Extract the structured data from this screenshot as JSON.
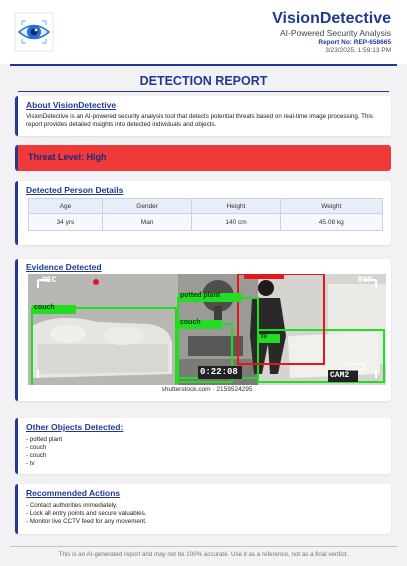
{
  "header": {
    "brand_name": "VisionDetective",
    "tagline": "AI-Powered Security Analysis",
    "report_no": "Report No: REP-658665",
    "report_date": "3/23/2025, 1:59:13 PM"
  },
  "title": "DETECTION REPORT",
  "about": {
    "heading": "About VisionDetective",
    "text": "VisionDetective is an AI-powered security analysis tool that detects potential threats based on real-time image processing. This report provides detailed insights into detected individuals and objects."
  },
  "threat": {
    "label": "Threat Level: High"
  },
  "person": {
    "heading": "Detected Person Details",
    "columns": [
      "Age",
      "Gender",
      "Height",
      "Weight"
    ],
    "values": [
      "34 yrs",
      "Man",
      "140 cm",
      "45.08 kg"
    ]
  },
  "evidence": {
    "heading": "Evidence Detected",
    "overlay": {
      "rec": "REC",
      "res": "80P",
      "timestamp": "0:22:08",
      "cam": "CAM2",
      "watermark": "shutterstock.com · 2159524295",
      "labels": [
        "couch",
        "potted plant",
        "couch",
        "tv"
      ]
    }
  },
  "others": {
    "heading": "Other Objects Detected:",
    "items": [
      "- potted plant",
      "- couch",
      "- couch",
      "- tv"
    ]
  },
  "actions": {
    "heading": "Recommended Actions",
    "items": [
      "- Contact authorities immediately.",
      "- Lock all entry points and secure valuables.",
      "- Monitor live CCTV feed for any movement."
    ]
  },
  "footer": "This is an AI-generated report and may not be 100% accurate. Use it as a reference, not as a final verdict.",
  "colors": {
    "brand": "#1f3a93",
    "threat": "#f03a3a",
    "detect_green": "#22dd22",
    "detect_red": "#e01818"
  }
}
